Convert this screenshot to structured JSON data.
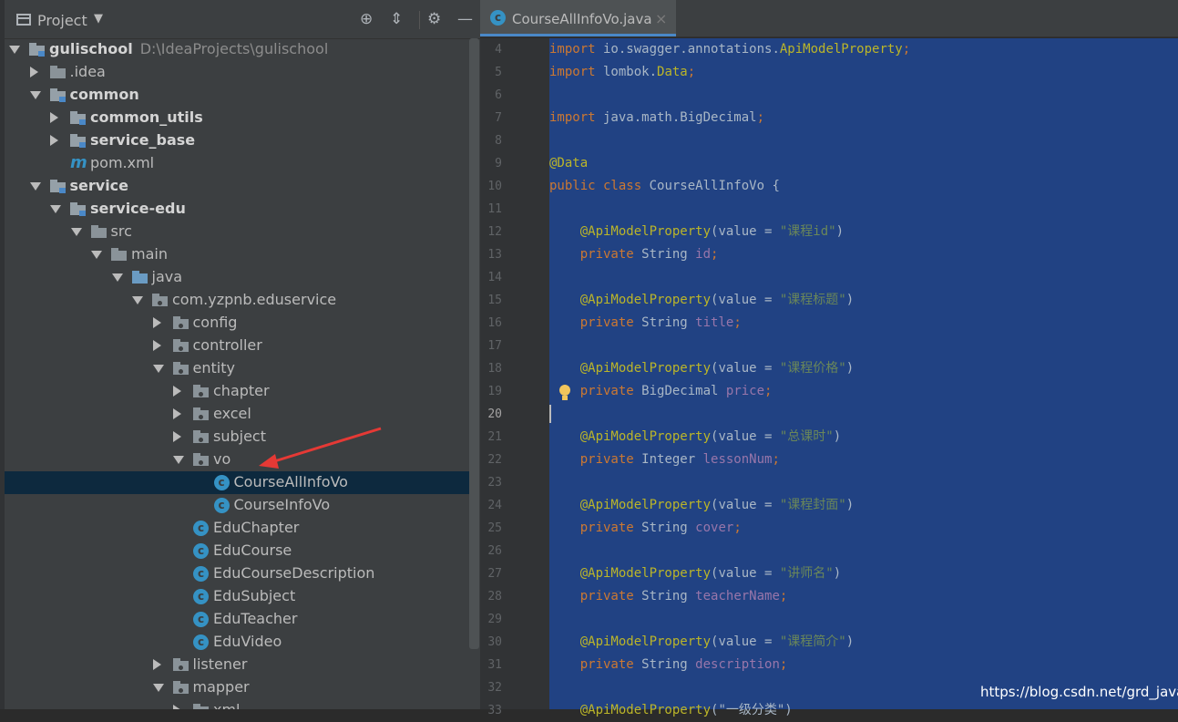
{
  "project_panel": {
    "title": "Project",
    "tree": [
      {
        "label": "gulischool",
        "path": "D:\\IdeaProjects\\gulischool",
        "bold": true,
        "depth": 0,
        "arrow": "down",
        "icon": "module-folder"
      },
      {
        "label": ".idea",
        "depth": 1,
        "arrow": "right",
        "icon": "folder"
      },
      {
        "label": "common",
        "bold": true,
        "depth": 1,
        "arrow": "down",
        "icon": "module-folder"
      },
      {
        "label": "common_utils",
        "bold": true,
        "depth": 2,
        "arrow": "right",
        "icon": "module-folder"
      },
      {
        "label": "service_base",
        "bold": true,
        "depth": 2,
        "arrow": "right",
        "icon": "module-folder"
      },
      {
        "label": "pom.xml",
        "depth": 2,
        "arrow": "none",
        "icon": "maven"
      },
      {
        "label": "service",
        "bold": true,
        "depth": 1,
        "arrow": "down",
        "icon": "module-folder"
      },
      {
        "label": "service-edu",
        "bold": true,
        "depth": 2,
        "arrow": "down",
        "icon": "module-folder"
      },
      {
        "label": "src",
        "depth": 3,
        "arrow": "down",
        "icon": "folder"
      },
      {
        "label": "main",
        "depth": 4,
        "arrow": "down",
        "icon": "folder"
      },
      {
        "label": "java",
        "depth": 5,
        "arrow": "down",
        "icon": "source-folder"
      },
      {
        "label": "com.yzpnb.eduservice",
        "depth": 6,
        "arrow": "down",
        "icon": "package"
      },
      {
        "label": "config",
        "depth": 7,
        "arrow": "right",
        "icon": "package"
      },
      {
        "label": "controller",
        "depth": 7,
        "arrow": "right",
        "icon": "package"
      },
      {
        "label": "entity",
        "depth": 7,
        "arrow": "down",
        "icon": "package"
      },
      {
        "label": "chapter",
        "depth": 8,
        "arrow": "right",
        "icon": "package"
      },
      {
        "label": "excel",
        "depth": 8,
        "arrow": "right",
        "icon": "package"
      },
      {
        "label": "subject",
        "depth": 8,
        "arrow": "right",
        "icon": "package"
      },
      {
        "label": "vo",
        "depth": 8,
        "arrow": "down",
        "icon": "package"
      },
      {
        "label": "CourseAllInfoVo",
        "depth": 9,
        "arrow": "none",
        "icon": "class",
        "selected": true
      },
      {
        "label": "CourseInfoVo",
        "depth": 9,
        "arrow": "none",
        "icon": "class"
      },
      {
        "label": "EduChapter",
        "depth": 8,
        "arrow": "none",
        "icon": "class"
      },
      {
        "label": "EduCourse",
        "depth": 8,
        "arrow": "none",
        "icon": "class"
      },
      {
        "label": "EduCourseDescription",
        "depth": 8,
        "arrow": "none",
        "icon": "class"
      },
      {
        "label": "EduSubject",
        "depth": 8,
        "arrow": "none",
        "icon": "class"
      },
      {
        "label": "EduTeacher",
        "depth": 8,
        "arrow": "none",
        "icon": "class"
      },
      {
        "label": "EduVideo",
        "depth": 8,
        "arrow": "none",
        "icon": "class"
      },
      {
        "label": "listener",
        "depth": 7,
        "arrow": "right",
        "icon": "package"
      },
      {
        "label": "mapper",
        "depth": 7,
        "arrow": "down",
        "icon": "package"
      },
      {
        "label": "xml",
        "depth": 8,
        "arrow": "right",
        "icon": "package"
      }
    ]
  },
  "editor": {
    "tab_label": "CourseAllInfoVo.java",
    "current_line": "20",
    "lines": [
      {
        "n": "4",
        "tokens": [
          {
            "t": "import",
            "c": "kw"
          },
          {
            "t": " io.swagger.annotations."
          },
          {
            "t": "ApiModelProperty",
            "c": "an"
          },
          {
            "t": ";",
            "c": "kw"
          }
        ]
      },
      {
        "n": "5",
        "tokens": [
          {
            "t": "import",
            "c": "kw"
          },
          {
            "t": " lombok."
          },
          {
            "t": "Data",
            "c": "an"
          },
          {
            "t": ";",
            "c": "kw"
          }
        ]
      },
      {
        "n": "6",
        "tokens": []
      },
      {
        "n": "7",
        "tokens": [
          {
            "t": "import",
            "c": "kw"
          },
          {
            "t": " java.math.BigDecimal"
          },
          {
            "t": ";",
            "c": "kw"
          }
        ]
      },
      {
        "n": "8",
        "tokens": []
      },
      {
        "n": "9",
        "tokens": [
          {
            "t": "@Data",
            "c": "an"
          }
        ]
      },
      {
        "n": "10",
        "tokens": [
          {
            "t": "public class",
            "c": "kw"
          },
          {
            "t": " CourseAllInfoVo {"
          }
        ]
      },
      {
        "n": "11",
        "tokens": []
      },
      {
        "n": "12",
        "tokens": [
          {
            "t": "    "
          },
          {
            "t": "@ApiModelProperty",
            "c": "an"
          },
          {
            "t": "(value = "
          },
          {
            "t": "\"课程id\"",
            "c": "st"
          },
          {
            "t": ")"
          }
        ]
      },
      {
        "n": "13",
        "tokens": [
          {
            "t": "    "
          },
          {
            "t": "private",
            "c": "kw"
          },
          {
            "t": " String "
          },
          {
            "t": "id",
            "c": "fd"
          },
          {
            "t": ";",
            "c": "kw"
          }
        ]
      },
      {
        "n": "14",
        "tokens": []
      },
      {
        "n": "15",
        "tokens": [
          {
            "t": "    "
          },
          {
            "t": "@ApiModelProperty",
            "c": "an"
          },
          {
            "t": "(value = "
          },
          {
            "t": "\"课程标题\"",
            "c": "st"
          },
          {
            "t": ")"
          }
        ]
      },
      {
        "n": "16",
        "tokens": [
          {
            "t": "    "
          },
          {
            "t": "private",
            "c": "kw"
          },
          {
            "t": " String "
          },
          {
            "t": "title",
            "c": "fd"
          },
          {
            "t": ";",
            "c": "kw"
          }
        ]
      },
      {
        "n": "17",
        "tokens": []
      },
      {
        "n": "18",
        "tokens": [
          {
            "t": "    "
          },
          {
            "t": "@ApiModelProperty",
            "c": "an"
          },
          {
            "t": "(value = "
          },
          {
            "t": "\"课程价格\"",
            "c": "st"
          },
          {
            "t": ")"
          }
        ]
      },
      {
        "n": "19",
        "tokens": [
          {
            "t": "    "
          },
          {
            "t": "private",
            "c": "kw"
          },
          {
            "t": " BigDecimal "
          },
          {
            "t": "price",
            "c": "fd"
          },
          {
            "t": ";",
            "c": "kw"
          }
        ]
      },
      {
        "n": "20",
        "tokens": []
      },
      {
        "n": "21",
        "tokens": [
          {
            "t": "    "
          },
          {
            "t": "@ApiModelProperty",
            "c": "an"
          },
          {
            "t": "(value = "
          },
          {
            "t": "\"总课时\"",
            "c": "st"
          },
          {
            "t": ")"
          }
        ]
      },
      {
        "n": "22",
        "tokens": [
          {
            "t": "    "
          },
          {
            "t": "private",
            "c": "kw"
          },
          {
            "t": " Integer "
          },
          {
            "t": "lessonNum",
            "c": "fd"
          },
          {
            "t": ";",
            "c": "kw"
          }
        ]
      },
      {
        "n": "23",
        "tokens": []
      },
      {
        "n": "24",
        "tokens": [
          {
            "t": "    "
          },
          {
            "t": "@ApiModelProperty",
            "c": "an"
          },
          {
            "t": "(value = "
          },
          {
            "t": "\"课程封面\"",
            "c": "st"
          },
          {
            "t": ")"
          }
        ]
      },
      {
        "n": "25",
        "tokens": [
          {
            "t": "    "
          },
          {
            "t": "private",
            "c": "kw"
          },
          {
            "t": " String "
          },
          {
            "t": "cover",
            "c": "fd"
          },
          {
            "t": ";",
            "c": "kw"
          }
        ]
      },
      {
        "n": "26",
        "tokens": []
      },
      {
        "n": "27",
        "tokens": [
          {
            "t": "    "
          },
          {
            "t": "@ApiModelProperty",
            "c": "an"
          },
          {
            "t": "(value = "
          },
          {
            "t": "\"讲师名\"",
            "c": "st"
          },
          {
            "t": ")"
          }
        ]
      },
      {
        "n": "28",
        "tokens": [
          {
            "t": "    "
          },
          {
            "t": "private",
            "c": "kw"
          },
          {
            "t": " String "
          },
          {
            "t": "teacherName",
            "c": "fd"
          },
          {
            "t": ";",
            "c": "kw"
          }
        ]
      },
      {
        "n": "29",
        "tokens": []
      },
      {
        "n": "30",
        "tokens": [
          {
            "t": "    "
          },
          {
            "t": "@ApiModelProperty",
            "c": "an"
          },
          {
            "t": "(value = "
          },
          {
            "t": "\"课程简介\"",
            "c": "st"
          },
          {
            "t": ")"
          }
        ]
      },
      {
        "n": "31",
        "tokens": [
          {
            "t": "    "
          },
          {
            "t": "private",
            "c": "kw"
          },
          {
            "t": " String "
          },
          {
            "t": "description",
            "c": "fd"
          },
          {
            "t": ";",
            "c": "kw"
          }
        ]
      },
      {
        "n": "32",
        "tokens": []
      },
      {
        "n": "33",
        "tokens": [
          {
            "t": "    "
          },
          {
            "t": "@ApiModelProperty",
            "c": "an"
          },
          {
            "t": "(\"一级分类\")"
          }
        ]
      }
    ]
  },
  "watermark": "https://blog.csdn.net/grd_java",
  "colors": {
    "keyword": "#cc7832",
    "annotation": "#bbb529",
    "string": "#6a8759",
    "field": "#9876aa",
    "selection": "#214283",
    "tree_selection": "#0d293e",
    "arrow": "#e53935"
  }
}
